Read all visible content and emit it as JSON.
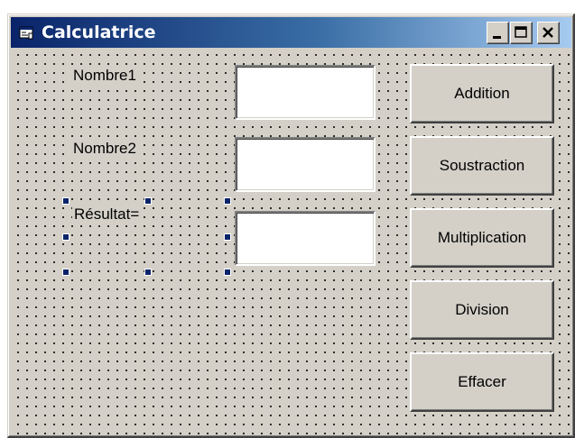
{
  "window": {
    "title": "Calculatrice",
    "icon": "form-icon",
    "caption_buttons": [
      "minimize-icon",
      "maximize-icon",
      "close-icon"
    ]
  },
  "form": {
    "labels": {
      "nombre1": "Nombre1",
      "nombre2": "Nombre2",
      "resultat": "Résultat="
    },
    "inputs": {
      "nombre1": "",
      "nombre2": "",
      "resultat": ""
    },
    "buttons": {
      "addition": "Addition",
      "soustraction": "Soustraction",
      "multiplication": "Multiplication",
      "division": "Division",
      "effacer": "Effacer"
    },
    "selected_control": "resultat-label"
  },
  "colors": {
    "face": "#d4d0c8",
    "title_start": "#0a246a",
    "title_end": "#a6caf0",
    "selection_handle": "#0a246a"
  }
}
